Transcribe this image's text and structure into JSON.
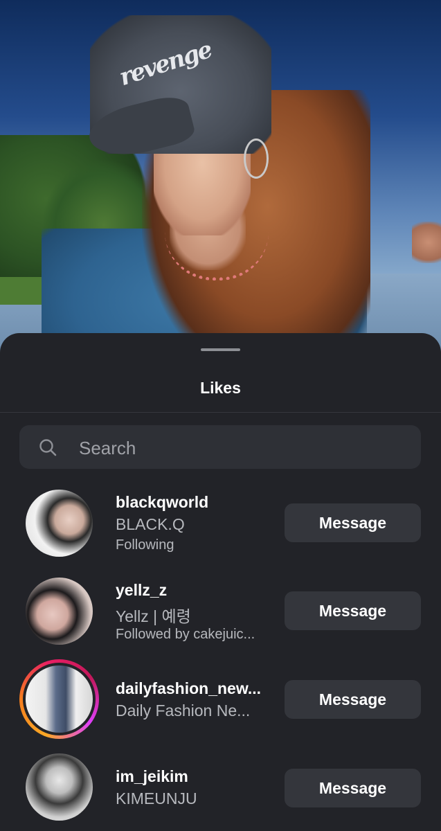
{
  "sheet": {
    "title": "Likes",
    "search_placeholder": "Search"
  },
  "likes": [
    {
      "username": "blackqworld",
      "full_name": "BLACK.Q",
      "subtitle": "Following",
      "button": "Message",
      "story_ring": false
    },
    {
      "username": "yellz_z",
      "full_name": "Yellz | 예령",
      "subtitle": "Followed by cakejuic...",
      "button": "Message",
      "story_ring": false
    },
    {
      "username": "dailyfashion_new...",
      "full_name": "Daily Fashion Ne...",
      "subtitle": "",
      "button": "Message",
      "story_ring": true
    },
    {
      "username": "im_jeikim",
      "full_name": "KIMEUNJU",
      "subtitle": "",
      "button": "Message",
      "story_ring": false
    }
  ],
  "background_photo": {
    "cap_text": "revenge"
  },
  "colors": {
    "sheet_bg": "#222328",
    "button_bg": "#34363c",
    "search_bg": "#2e3036",
    "secondary_text": "#b7b9be",
    "story_ring": [
      "#f9a825",
      "#e91e63",
      "#e040fb"
    ]
  }
}
